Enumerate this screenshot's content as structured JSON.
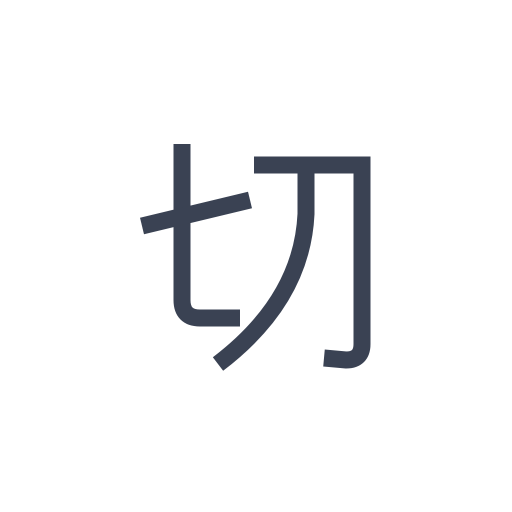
{
  "glyph": {
    "character": "切",
    "icon": "cut-character-icon",
    "color": "#3a4253",
    "background": "#ffffff"
  }
}
